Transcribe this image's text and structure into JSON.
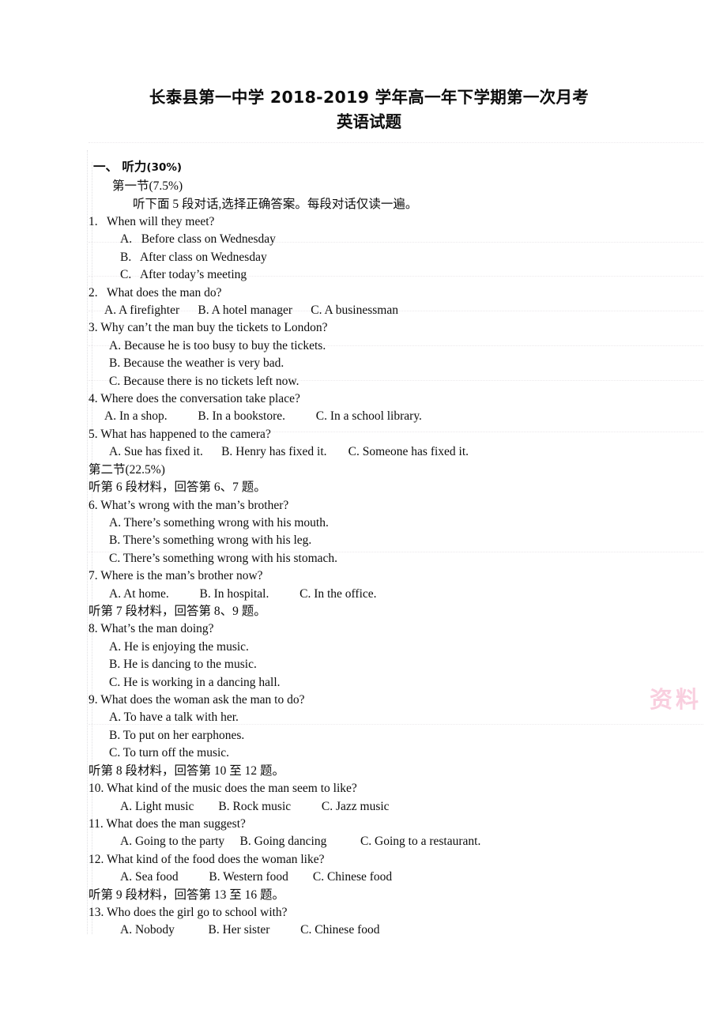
{
  "document": {
    "title": "长泰县第一中学 2018-2019 学年高一年下学期第一次月考",
    "subtitle": "英语试题",
    "watermark": "资料"
  },
  "section": {
    "heading_label": "一、 听力",
    "heading_points": "(30%)",
    "part_one": "第一节(7.5%)",
    "part_one_instruction": "听下面 5 段对话,选择正确答案。每段对话仅读一遍。",
    "part_two": "第二节(22.5%)"
  },
  "cues": {
    "cue_6_7": "听第 6 段材料，回答第 6、7 题。",
    "cue_8_9": "听第 7 段材料，回答第 8、9 题。",
    "cue_10_12": "听第 8 段材料，回答第 10 至 12 题。",
    "cue_13_16": "听第 9 段材料，回答第 13 至 16 题。"
  },
  "questions": [
    {
      "stem": "1.   When will they meet?",
      "options": [
        "A.   Before class on Wednesday",
        "B.   After class on Wednesday",
        "C.   After today’s meeting"
      ]
    },
    {
      "stem": "2.   What does the man do?",
      "options": [
        "A. A firefighter      B. A hotel manager      C. A businessman"
      ]
    },
    {
      "stem": "3. Why can’t the man buy the tickets to London?",
      "options": [
        "A. Because he is too busy to buy the tickets.",
        "B. Because the weather is very bad.",
        "C. Because there is no tickets left now."
      ]
    },
    {
      "stem": "4. Where does the conversation take place?",
      "options": [
        "A. In a shop.          B. In a bookstore.          C. In a school library."
      ]
    },
    {
      "stem": "5. What has happened to the camera?",
      "options": [
        "A. Sue has fixed it.      B. Henry has fixed it.       C. Someone has fixed it."
      ]
    },
    {
      "stem": "6. What’s wrong with the man’s brother?",
      "options": [
        "A. There’s something wrong with his mouth.",
        "B. There’s something wrong with his leg.",
        "C. There’s something wrong with his stomach."
      ]
    },
    {
      "stem": "7. Where is the man’s brother now?",
      "options": [
        "A. At home.          B. In hospital.          C. In the office."
      ]
    },
    {
      "stem": "8. What’s the man doing?",
      "options": [
        "A. He is enjoying the music.",
        "B. He is dancing to the music.",
        "C. He is working in a dancing hall."
      ]
    },
    {
      "stem": "9. What does the woman ask the man to do?",
      "options": [
        "A. To have a talk with her.",
        "B. To put on her earphones.",
        "C. To turn off the music."
      ]
    },
    {
      "stem": "10. What kind of the music does the man seem to like?",
      "options": [
        "A. Light music        B. Rock music          C. Jazz music"
      ]
    },
    {
      "stem": "11. What does the man suggest?",
      "options": [
        "A. Going to the party     B. Going dancing           C. Going to a restaurant."
      ]
    },
    {
      "stem": "12. What kind of the food does the woman like?",
      "options": [
        "A. Sea food          B. Western food        C. Chinese food"
      ]
    },
    {
      "stem": "13. Who does the girl go to school with?",
      "options": [
        "A. Nobody           B. Her sister          C. Chinese food"
      ]
    }
  ]
}
